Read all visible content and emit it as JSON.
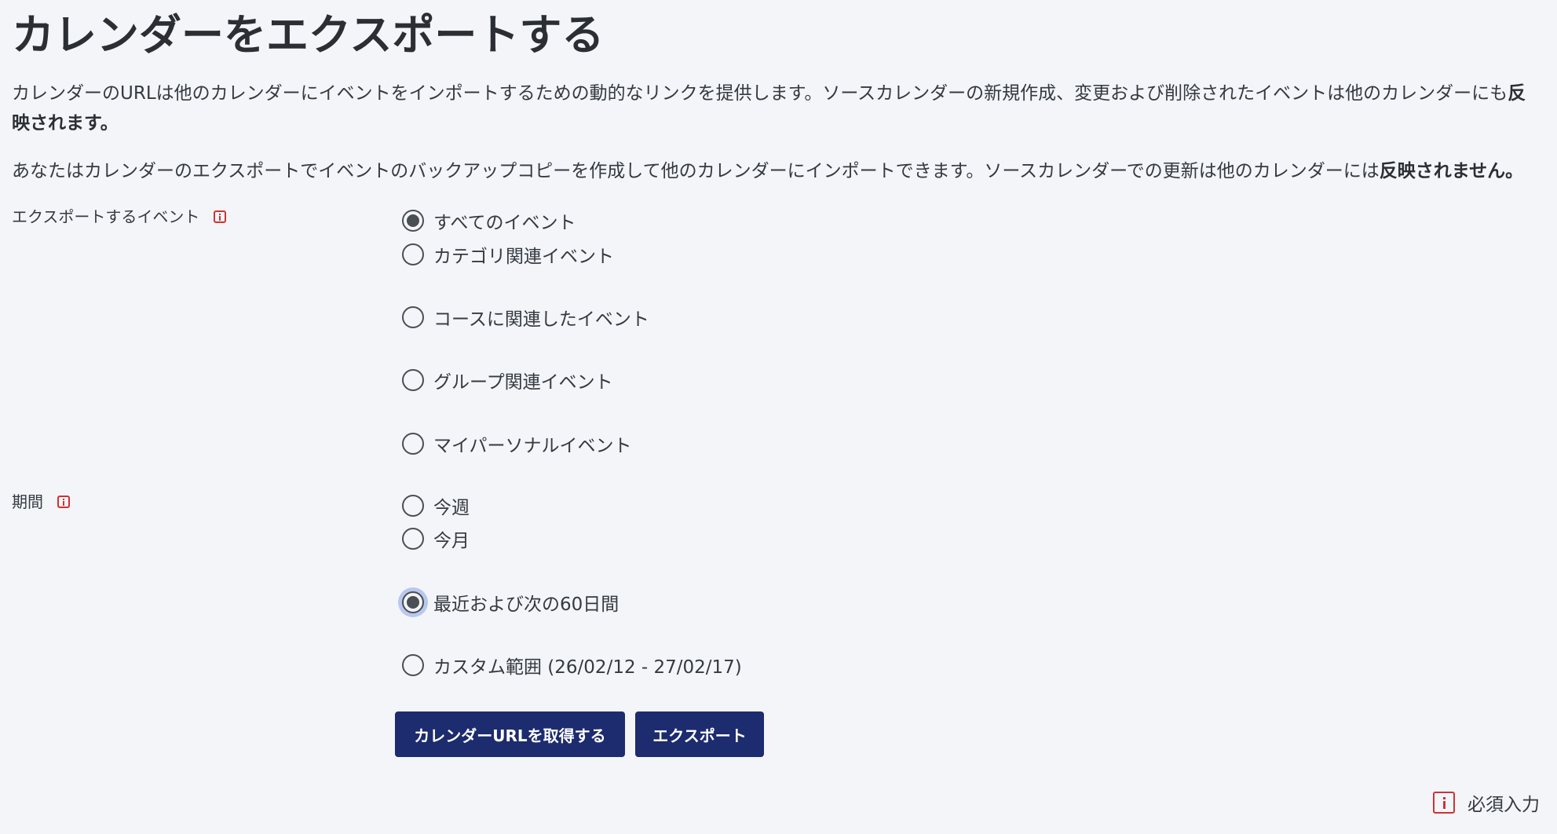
{
  "page": {
    "title": "カレンダーをエクスポートする"
  },
  "intro": {
    "paragraph1_text": "カレンダーのURLは他のカレンダーにイベントをインポートするための動的なリンクを提供します。ソースカレンダーの新規作成、変更および削除されたイベントは他のカレンダーにも",
    "paragraph1_bold": "反映されます。",
    "paragraph2_text": "あなたはカレンダーのエクスポートでイベントのバックアップコピーを作成して他のカレンダーにインポートできます。ソースカレンダーでの更新は他のカレンダーには",
    "paragraph2_bold": "反映されません。"
  },
  "events": {
    "label": "エクスポートするイベント",
    "icon": "info-icon",
    "options": [
      {
        "label": "すべてのイベント",
        "checked": true
      },
      {
        "label": "カテゴリ関連イベント",
        "checked": false
      },
      {
        "label": "コースに関連したイベント",
        "checked": false
      },
      {
        "label": "グループ関連イベント",
        "checked": false
      },
      {
        "label": "マイパーソナルイベント",
        "checked": false
      }
    ]
  },
  "period": {
    "label": "期間",
    "icon": "info-icon",
    "options": [
      {
        "label": "今週",
        "checked": false
      },
      {
        "label": "今月",
        "checked": false
      },
      {
        "label": "最近および次の60日間",
        "checked": true,
        "focused": true
      },
      {
        "label": "カスタム範囲 (26/02/12 - 27/02/17)",
        "checked": false
      }
    ]
  },
  "buttons": {
    "get_url_label": "カレンダーURLを取得する",
    "export_label": "エクスポート"
  },
  "footer": {
    "required_label": "必須入力",
    "icon": "info-icon"
  },
  "colors": {
    "background": "#f3f5f9",
    "button": "#1d2b6f",
    "required_icon": "#cf3333",
    "focus_ring": "#b8c8ee"
  }
}
